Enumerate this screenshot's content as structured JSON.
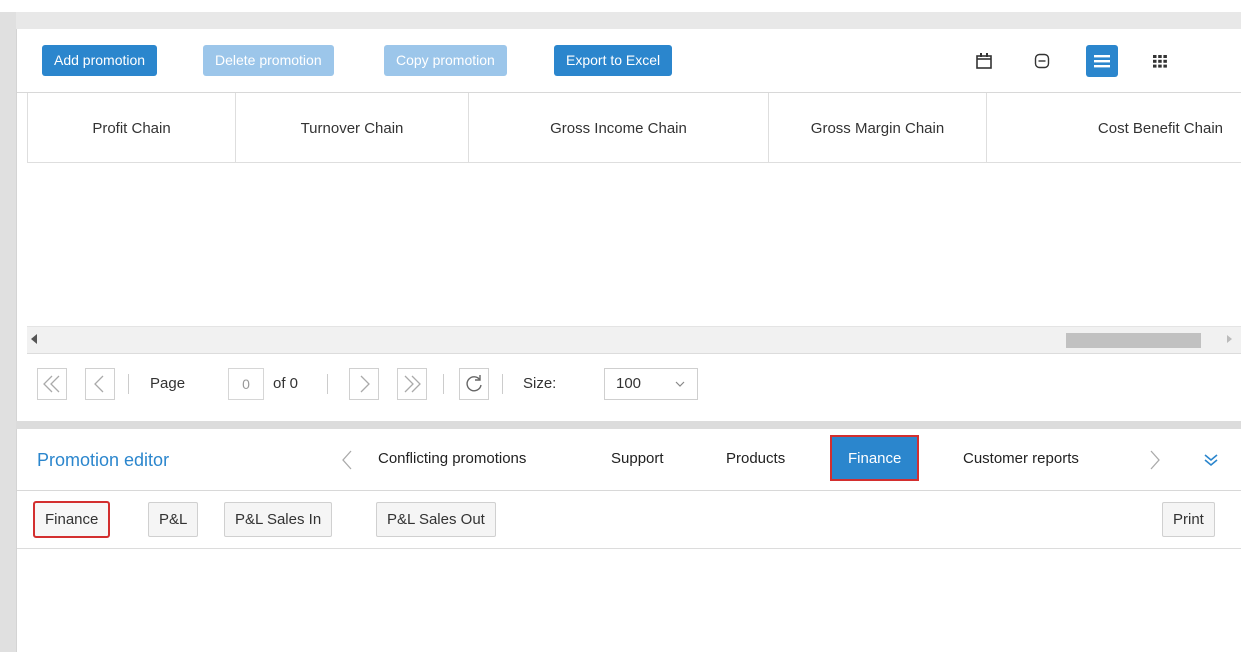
{
  "toolbar": {
    "add_label": "Add promotion",
    "delete_label": "Delete promotion",
    "copy_label": "Copy promotion",
    "export_label": "Export to Excel",
    "icons": [
      "calendar-icon",
      "collapse-icon",
      "list-view-icon",
      "grid-view-icon"
    ]
  },
  "grid": {
    "columns": [
      "Profit Chain",
      "Turnover Chain",
      "Gross Income Chain",
      "Gross Margin Chain",
      "Cost Benefit Chain"
    ]
  },
  "pager": {
    "page_label": "Page",
    "page_value": "0",
    "of_label": "of 0",
    "size_label": "Size:",
    "size_value": "100"
  },
  "editor": {
    "title": "Promotion editor",
    "tabs": [
      "Conflicting promotions",
      "Support",
      "Products",
      "Finance",
      "Customer reports"
    ],
    "active_tab": "Finance",
    "subtabs": [
      "Finance",
      "P&L",
      "P&L Sales In",
      "P&L Sales Out"
    ],
    "print_label": "Print"
  },
  "colors": {
    "accent": "#2b86cd",
    "accent_disabled": "#9cc6ea",
    "highlight": "#d32f2f"
  }
}
